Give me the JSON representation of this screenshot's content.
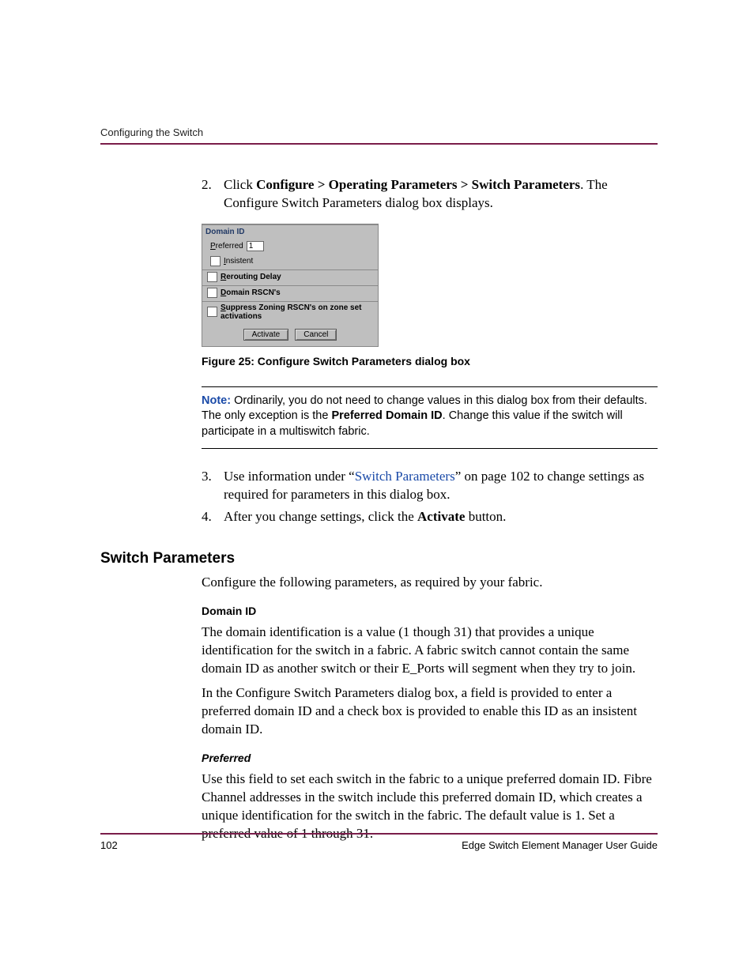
{
  "header": {
    "running": "Configuring the Switch"
  },
  "step2": {
    "num": "2.",
    "pre": "Click ",
    "bold": "Configure > Operating Parameters > Switch Parameters",
    "post": ". The Configure Switch Parameters dialog box displays."
  },
  "dialog": {
    "domain_id_heading": "Domain ID",
    "preferred_label_pre": "P",
    "preferred_label_post": "referred",
    "preferred_value": "1",
    "insistent_u": "I",
    "insistent_rest": "nsistent",
    "rerouting_u": "R",
    "rerouting_rest": "erouting Delay",
    "domain_rscn_u": "D",
    "domain_rscn_rest": "omain RSCN's",
    "suppress_u": "S",
    "suppress_rest": "uppress Zoning RSCN's on zone set activations",
    "activate": "Activate",
    "cancel": "Cancel"
  },
  "figcaption": "Figure 25:  Configure Switch Parameters dialog box",
  "note": {
    "label": "Note:",
    "t1": "  Ordinarily, you do not need to change values in this dialog box from their defaults. The only exception is the ",
    "bold": "Preferred Domain ID",
    "t2": ". Change this value if the switch will participate in a multiswitch fabric."
  },
  "step3": {
    "num": "3.",
    "pre": "Use information under “",
    "link": "Switch Parameters",
    "post": "” on page 102 to change settings as required for parameters in this dialog box."
  },
  "step4": {
    "num": "4.",
    "pre": "After you change settings, click the ",
    "bold": "Activate",
    "post": " button."
  },
  "h2": "Switch Parameters",
  "p_intro": "Configure the following parameters, as required by your fabric.",
  "h3_domain": "Domain ID",
  "p_domain1": "The domain identification is a value (1 though 31) that provides a unique identification for the switch in a fabric. A fabric switch cannot contain the same domain ID as another switch or their E_Ports will segment when they try to join.",
  "p_domain2": "In the Configure Switch Parameters dialog box, a field is provided to enter a preferred domain ID and a check box is provided to enable this ID as an insistent domain ID.",
  "h4_preferred": "Preferred",
  "p_preferred": "Use this field to set each switch in the fabric to a unique preferred domain ID. Fibre Channel addresses in the switch include this preferred domain ID, which creates a unique identification for the switch in the fabric. The default value is 1. Set a preferred value of 1 through 31.",
  "footer": {
    "page": "102",
    "title": "Edge Switch Element Manager User Guide"
  }
}
